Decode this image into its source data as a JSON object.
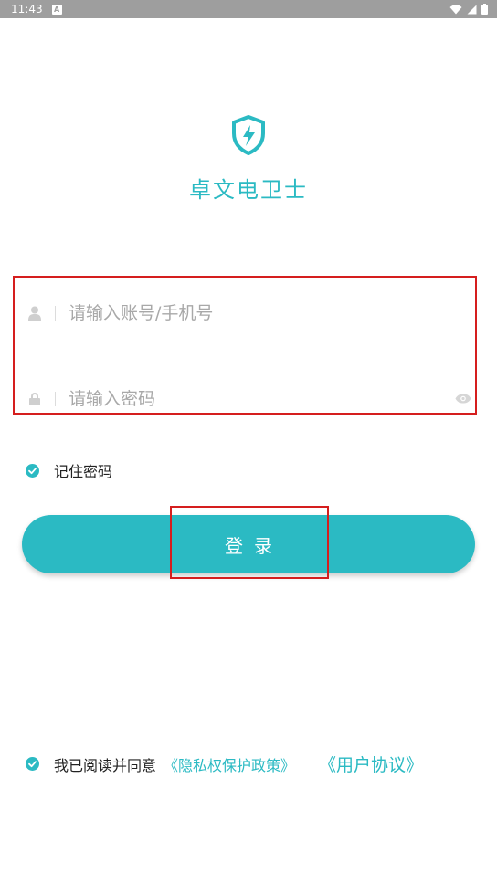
{
  "status_bar": {
    "time": "11:43",
    "notification_letter": "A"
  },
  "app": {
    "name": "卓文电卫士",
    "logo_icon": "shield-bolt-icon",
    "accent_color": "#2bbac3"
  },
  "form": {
    "account": {
      "placeholder": "请输入账号/手机号",
      "value": "",
      "icon": "user-icon"
    },
    "password": {
      "placeholder": "请输入密码",
      "value": "",
      "icon": "lock-icon",
      "toggle_icon": "eye-icon"
    }
  },
  "remember": {
    "label": "记住密码",
    "checked": true
  },
  "login": {
    "label": "登录"
  },
  "agreement": {
    "prefix": "我已阅读并同意",
    "privacy_link": "《隐私权保护政策》",
    "terms_link": "《用户协议》",
    "checked": true
  },
  "highlight_color": "#d51e1e"
}
